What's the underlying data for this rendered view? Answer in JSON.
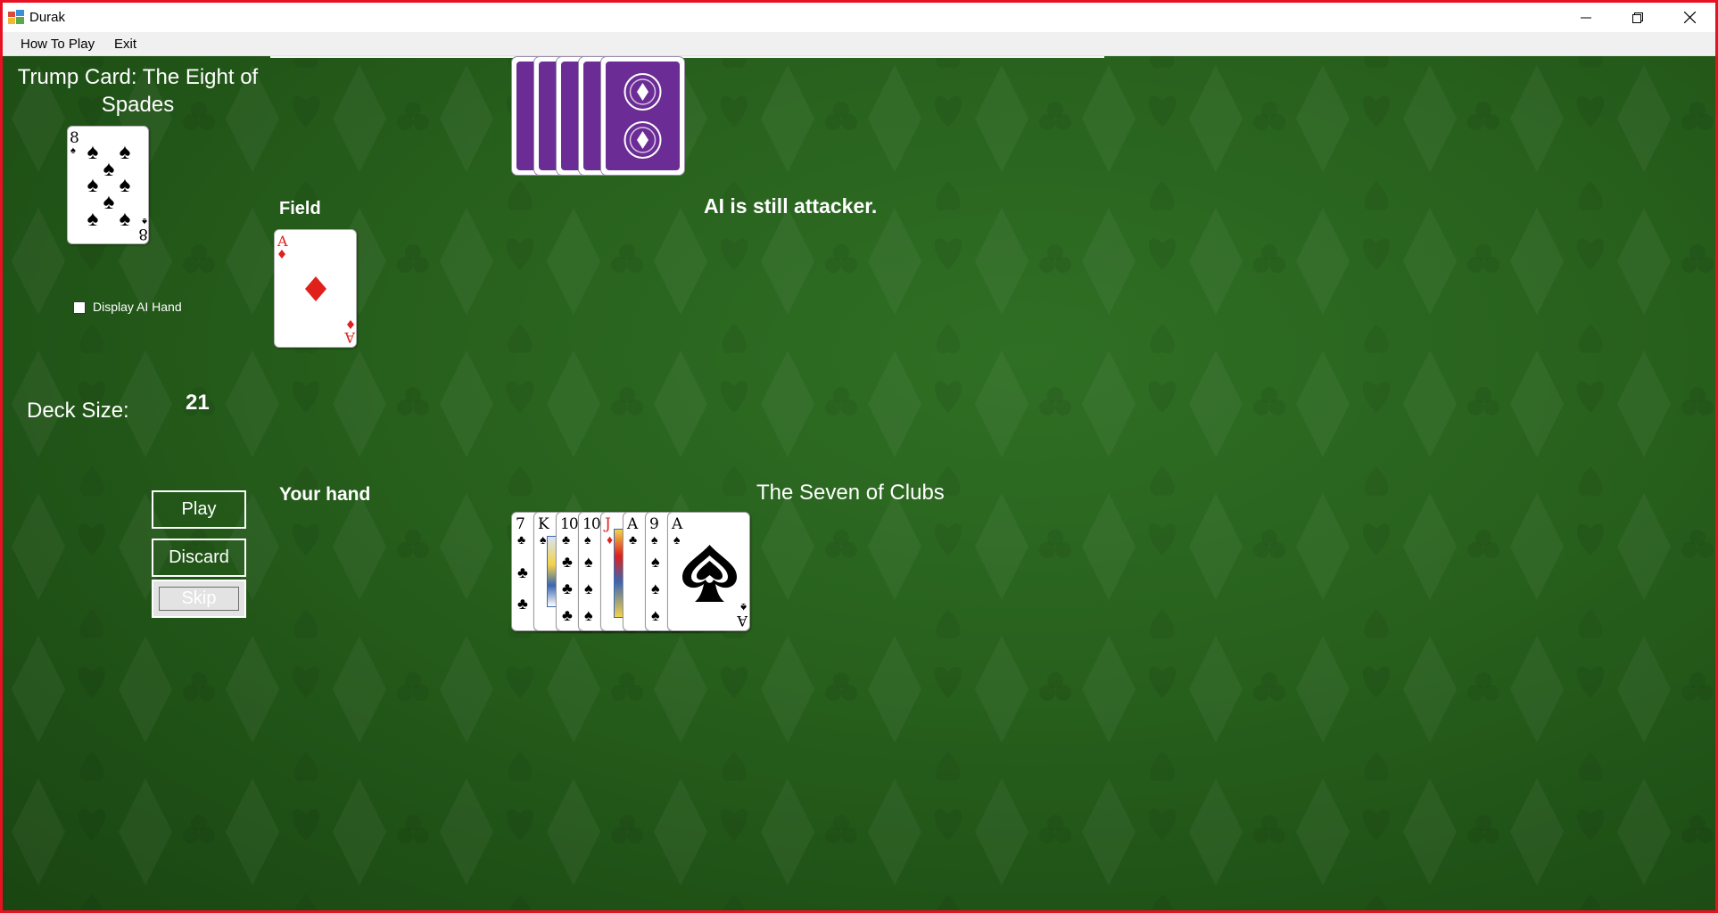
{
  "window": {
    "title": "Durak"
  },
  "menu": {
    "items": [
      "How To Play",
      "Exit"
    ]
  },
  "trump": {
    "title": "Trump Card: The Eight of Spades",
    "card": {
      "rank": "8",
      "suit": "spades"
    }
  },
  "options": {
    "display_ai_hand": {
      "label": "Display AI Hand",
      "checked": false
    }
  },
  "deck": {
    "label": "Deck Size:",
    "count": "21"
  },
  "field": {
    "label": "Field",
    "cards": [
      {
        "rank": "A",
        "suit": "diamonds"
      }
    ]
  },
  "ai_hand": {
    "card_count": 5,
    "back_color": "#6b2d95"
  },
  "status": {
    "message": "AI is still attacker."
  },
  "player": {
    "hand_label": "Your hand",
    "selected_card_text": "The Seven of Clubs",
    "hand": [
      {
        "rank": "7",
        "suit": "clubs"
      },
      {
        "rank": "K",
        "suit": "spades"
      },
      {
        "rank": "10",
        "suit": "clubs"
      },
      {
        "rank": "10",
        "suit": "spades"
      },
      {
        "rank": "J",
        "suit": "diamonds"
      },
      {
        "rank": "A",
        "suit": "clubs"
      },
      {
        "rank": "9",
        "suit": "spades"
      },
      {
        "rank": "A",
        "suit": "spades"
      }
    ]
  },
  "buttons": {
    "play": "Play",
    "discard": "Discard",
    "skip": "Skip"
  },
  "colors": {
    "table_green": "#28611d",
    "card_back": "#6b2d95",
    "red_suit": "#e0201b",
    "window_border": "#e81123"
  }
}
